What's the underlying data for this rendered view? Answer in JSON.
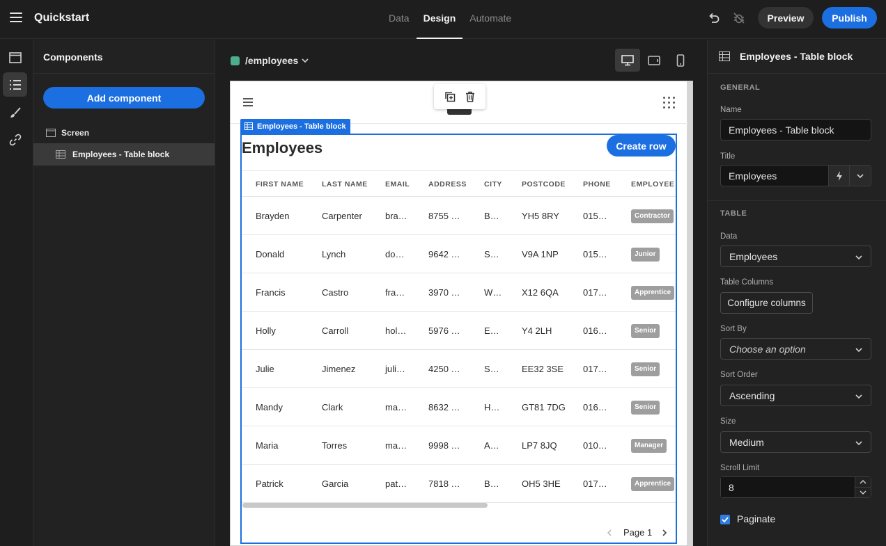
{
  "app": {
    "title": "Quickstart"
  },
  "nav": {
    "tabs": [
      {
        "label": "Data"
      },
      {
        "label": "Design"
      },
      {
        "label": "Automate"
      }
    ]
  },
  "header": {
    "preview_label": "Preview",
    "publish_label": "Publish"
  },
  "left_panel": {
    "title": "Components",
    "add_label": "Add component",
    "tree": {
      "screen": "Screen",
      "table_block": "Employees - Table block"
    }
  },
  "center": {
    "route": "/employees",
    "route_color": "#4cae8a",
    "selection_tag": "Employees - Table block",
    "block_title": "Employees",
    "create_label": "Create row",
    "columns": [
      "FIRST NAME",
      "LAST NAME",
      "EMAIL",
      "ADDRESS",
      "CITY",
      "POSTCODE",
      "PHONE",
      "EMPLOYEE L"
    ],
    "rows": [
      {
        "first": "Brayden",
        "last": "Carpenter",
        "email": "bra…",
        "address": "8755 …",
        "city": "B…",
        "postcode": "YH5 8RY",
        "phone": "015…",
        "level": "Contractor"
      },
      {
        "first": "Donald",
        "last": "Lynch",
        "email": "do…",
        "address": "9642 …",
        "city": "S…",
        "postcode": "V9A 1NP",
        "phone": "015…",
        "level": "Junior"
      },
      {
        "first": "Francis",
        "last": "Castro",
        "email": "fra…",
        "address": "3970 …",
        "city": "W…",
        "postcode": "X12 6QA",
        "phone": "017…",
        "level": "Apprentice"
      },
      {
        "first": "Holly",
        "last": "Carroll",
        "email": "hol…",
        "address": "5976 …",
        "city": "E…",
        "postcode": "Y4 2LH",
        "phone": "016…",
        "level": "Senior"
      },
      {
        "first": "Julie",
        "last": "Jimenez",
        "email": "juli…",
        "address": "4250 …",
        "city": "S…",
        "postcode": "EE32 3SE",
        "phone": "017…",
        "level": "Senior"
      },
      {
        "first": "Mandy",
        "last": "Clark",
        "email": "ma…",
        "address": "8632 …",
        "city": "H…",
        "postcode": "GT81 7DG",
        "phone": "016…",
        "level": "Senior"
      },
      {
        "first": "Maria",
        "last": "Torres",
        "email": "ma…",
        "address": "9998 …",
        "city": "A…",
        "postcode": "LP7 8JQ",
        "phone": "010…",
        "level": "Manager"
      },
      {
        "first": "Patrick",
        "last": "Garcia",
        "email": "pat…",
        "address": "7818 …",
        "city": "B…",
        "postcode": "OH5 3HE",
        "phone": "017…",
        "level": "Apprentice"
      }
    ],
    "page_label": "Page 1"
  },
  "right_panel": {
    "title": "Employees - Table block",
    "general": {
      "section": "GENERAL",
      "name_label": "Name",
      "name_value": "Employees - Table block",
      "title_label": "Title",
      "title_value": "Employees"
    },
    "table": {
      "section": "TABLE",
      "data_label": "Data",
      "data_value": "Employees",
      "columns_label": "Table Columns",
      "columns_button": "Configure columns",
      "sort_by_label": "Sort By",
      "sort_by_placeholder": "Choose an option",
      "sort_order_label": "Sort Order",
      "sort_order_value": "Ascending",
      "size_label": "Size",
      "size_value": "Medium",
      "scroll_limit_label": "Scroll Limit",
      "scroll_limit_value": "8",
      "paginate_label": "Paginate",
      "paginate_checked": true
    }
  },
  "colors": {
    "accent": "#1c6fe0",
    "badge": "#9e9e9e"
  }
}
